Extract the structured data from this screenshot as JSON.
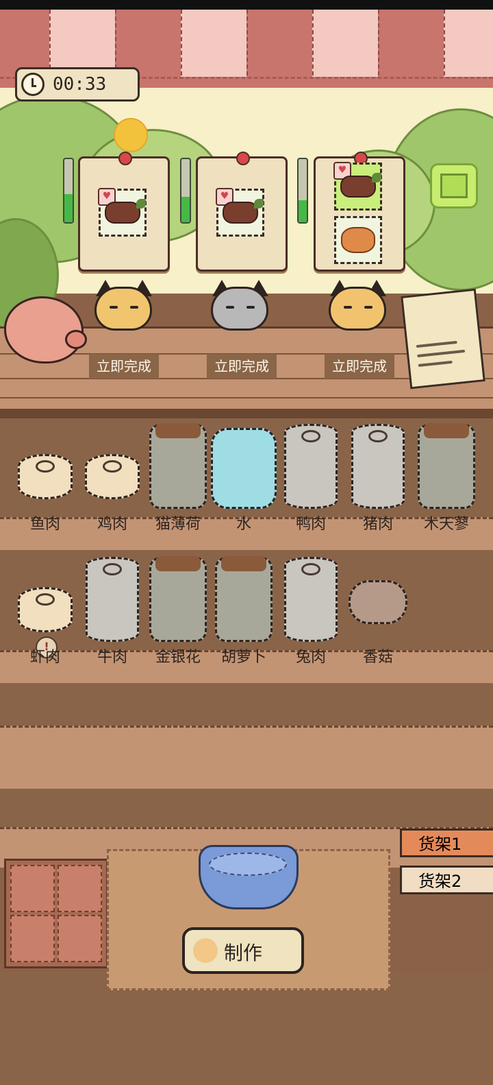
{
  "timer": {
    "time": "00:33",
    "icon": "clock-icon"
  },
  "orders": [
    {
      "items": [
        "meat-roast"
      ],
      "progress": 0.45
    },
    {
      "items": [
        "meat-roast"
      ],
      "progress": 0.4
    },
    {
      "items": [
        "meat-roast",
        "shrimp-dish"
      ],
      "progress": 0.35
    }
  ],
  "cats": [
    {
      "color": "#f1c56e",
      "done_label": "立即完成"
    },
    {
      "color": "#b8b8b8",
      "done_label": "立即完成"
    },
    {
      "color": "#f2c36f",
      "done_label": "立即完成"
    }
  ],
  "shelf_row1": [
    {
      "name": "鱼肉",
      "type": "can"
    },
    {
      "name": "鸡肉",
      "type": "can"
    },
    {
      "name": "猫薄荷",
      "type": "jar"
    },
    {
      "name": "水",
      "type": "water"
    },
    {
      "name": "鸭肉",
      "type": "tin"
    },
    {
      "name": "猪肉",
      "type": "tin"
    },
    {
      "name": "木天蓼",
      "type": "jar"
    }
  ],
  "shelf_row2": [
    {
      "name": "虾肉",
      "type": "can"
    },
    {
      "name": "牛肉",
      "type": "tin"
    },
    {
      "name": "金银花",
      "type": "jar"
    },
    {
      "name": "胡萝卜",
      "type": "jar"
    },
    {
      "name": "兔肉",
      "type": "tin"
    },
    {
      "name": "香菇",
      "type": "mushroom"
    }
  ],
  "shrimp_alert": "!",
  "make_button": "制作",
  "shelf_tabs": [
    "货架1",
    "货架2"
  ],
  "colors": {
    "accent_green": "#46b845",
    "tab_active": "#e48a5a",
    "tab_inactive": "#f0ddc4"
  }
}
